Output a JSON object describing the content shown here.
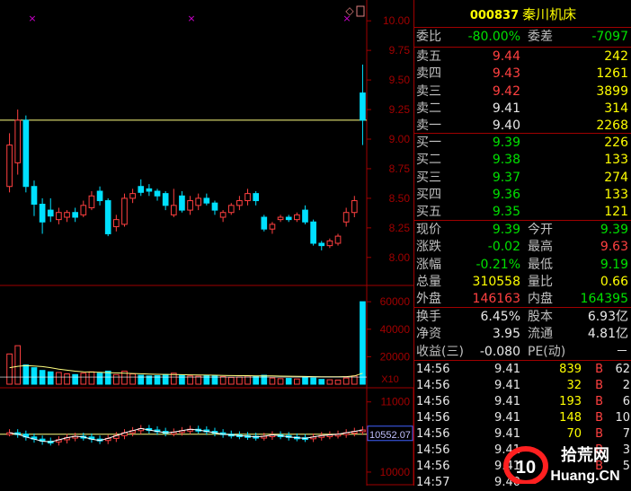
{
  "stock": {
    "code": "000837",
    "name": "秦川机床"
  },
  "weibi": {
    "label": "委比",
    "value": "-80.00%",
    "label2": "委差",
    "value2": "-7097"
  },
  "sell": [
    {
      "label": "卖五",
      "price": "9.44",
      "vol": "242"
    },
    {
      "label": "卖四",
      "price": "9.43",
      "vol": "1261"
    },
    {
      "label": "卖三",
      "price": "9.42",
      "vol": "3899"
    },
    {
      "label": "卖二",
      "price": "9.41",
      "vol": "314"
    },
    {
      "label": "卖一",
      "price": "9.40",
      "vol": "2268"
    }
  ],
  "buy": [
    {
      "label": "买一",
      "price": "9.39",
      "vol": "226"
    },
    {
      "label": "买二",
      "price": "9.38",
      "vol": "133"
    },
    {
      "label": "买三",
      "price": "9.37",
      "vol": "274"
    },
    {
      "label": "买四",
      "price": "9.36",
      "vol": "133"
    },
    {
      "label": "买五",
      "price": "9.35",
      "vol": "121"
    }
  ],
  "quote": [
    {
      "l1": "现价",
      "v1": "9.39",
      "l2": "今开",
      "v2": "9.39"
    },
    {
      "l1": "涨跌",
      "v1": "-0.02",
      "l2": "最高",
      "v2": "9.63"
    },
    {
      "l1": "涨幅",
      "v1": "-0.21%",
      "l2": "最低",
      "v2": "9.19"
    },
    {
      "l1": "总量",
      "v1": "310558",
      "l2": "量比",
      "v2": "0.66"
    },
    {
      "l1": "外盘",
      "v1": "146163",
      "l2": "内盘",
      "v2": "164395"
    }
  ],
  "fund": [
    {
      "l1": "换手",
      "v1": "6.45%",
      "l2": "股本",
      "v2": "6.93亿"
    },
    {
      "l1": "净资",
      "v1": "3.95",
      "l2": "流通",
      "v2": "4.81亿"
    },
    {
      "l1": "收益(三)",
      "v1": "-0.080",
      "l2": "PE(动)",
      "v2": "－"
    }
  ],
  "ticks": [
    {
      "time": "14:56",
      "price": "9.41",
      "vol": "839",
      "bs": "B",
      "num": "62"
    },
    {
      "time": "14:56",
      "price": "9.41",
      "vol": "32",
      "bs": "B",
      "num": "2"
    },
    {
      "time": "14:56",
      "price": "9.41",
      "vol": "193",
      "bs": "B",
      "num": "6"
    },
    {
      "time": "14:56",
      "price": "9.41",
      "vol": "148",
      "bs": "B",
      "num": "10"
    },
    {
      "time": "14:56",
      "price": "9.41",
      "vol": "70",
      "bs": "B",
      "num": "7"
    },
    {
      "time": "14:56",
      "price": "9.41",
      "vol": "",
      "bs": "B",
      "num": "3"
    },
    {
      "time": "14:56",
      "price": "9.41",
      "vol": "",
      "bs": "B",
      "num": "5"
    },
    {
      "time": "14:57",
      "price": "9.40",
      "vol": "",
      "bs": "",
      "num": ""
    }
  ],
  "axis": {
    "price": [
      "10.00",
      "9.75",
      "9.50",
      "9.25",
      "9.00",
      "8.75",
      "8.50",
      "8.25",
      "8.00"
    ],
    "volume": [
      "60000",
      "40000",
      "20000"
    ],
    "vol_unit": "X10",
    "index": [
      "11000",
      "10500",
      "10000"
    ],
    "index_current": "10552.07"
  },
  "watermark": {
    "line1": "拾荒网",
    "line2": "Huang.CN",
    "badge": "10"
  },
  "colors": {
    "up": "#ff4040",
    "down": "#00e0ff",
    "ma_line": "#ffff80",
    "grid": "#a00000"
  },
  "chart_data": {
    "type": "candlestick",
    "price_ylim": [
      7.9,
      10.1
    ],
    "reference_line": 9.16,
    "candles": [
      {
        "o": 8.6,
        "c": 8.95,
        "h": 9.05,
        "l": 8.55,
        "up": true
      },
      {
        "o": 8.8,
        "c": 9.16,
        "h": 9.25,
        "l": 8.7,
        "up": true
      },
      {
        "o": 9.16,
        "c": 8.6,
        "h": 9.2,
        "l": 8.55,
        "up": false
      },
      {
        "o": 8.6,
        "c": 8.45,
        "h": 8.65,
        "l": 8.35,
        "up": false
      },
      {
        "o": 8.45,
        "c": 8.3,
        "h": 8.5,
        "l": 8.2,
        "up": false
      },
      {
        "o": 8.4,
        "c": 8.35,
        "h": 8.5,
        "l": 8.3,
        "up": false
      },
      {
        "o": 8.32,
        "c": 8.38,
        "h": 8.42,
        "l": 8.28,
        "up": true
      },
      {
        "o": 8.34,
        "c": 8.38,
        "h": 8.4,
        "l": 8.3,
        "up": true
      },
      {
        "o": 8.38,
        "c": 8.34,
        "h": 8.42,
        "l": 8.3,
        "up": false
      },
      {
        "o": 8.36,
        "c": 8.44,
        "h": 8.48,
        "l": 8.34,
        "up": true
      },
      {
        "o": 8.42,
        "c": 8.52,
        "h": 8.56,
        "l": 8.4,
        "up": true
      },
      {
        "o": 8.56,
        "c": 8.48,
        "h": 8.6,
        "l": 8.44,
        "up": false
      },
      {
        "o": 8.48,
        "c": 8.2,
        "h": 8.5,
        "l": 8.18,
        "up": false
      },
      {
        "o": 8.26,
        "c": 8.32,
        "h": 8.36,
        "l": 8.22,
        "up": true
      },
      {
        "o": 8.28,
        "c": 8.5,
        "h": 8.54,
        "l": 8.26,
        "up": true
      },
      {
        "o": 8.5,
        "c": 8.54,
        "h": 8.58,
        "l": 8.46,
        "up": true
      },
      {
        "o": 8.55,
        "c": 8.6,
        "h": 8.66,
        "l": 8.52,
        "up": false
      },
      {
        "o": 8.58,
        "c": 8.56,
        "h": 8.62,
        "l": 8.52,
        "up": false
      },
      {
        "o": 8.56,
        "c": 8.52,
        "h": 8.58,
        "l": 8.48,
        "up": false
      },
      {
        "o": 8.54,
        "c": 8.44,
        "h": 8.56,
        "l": 8.4,
        "up": false
      },
      {
        "o": 8.44,
        "c": 8.36,
        "h": 8.58,
        "l": 8.34,
        "up": true
      },
      {
        "o": 8.52,
        "c": 8.4,
        "h": 8.56,
        "l": 8.38,
        "up": false
      },
      {
        "o": 8.4,
        "c": 8.48,
        "h": 8.52,
        "l": 8.36,
        "up": true
      },
      {
        "o": 8.44,
        "c": 8.5,
        "h": 8.54,
        "l": 8.4,
        "up": true
      },
      {
        "o": 8.5,
        "c": 8.46,
        "h": 8.54,
        "l": 8.44,
        "up": false
      },
      {
        "o": 8.46,
        "c": 8.4,
        "h": 8.48,
        "l": 8.36,
        "up": false
      },
      {
        "o": 8.34,
        "c": 8.38,
        "h": 8.4,
        "l": 8.3,
        "up": true
      },
      {
        "o": 8.38,
        "c": 8.44,
        "h": 8.46,
        "l": 8.36,
        "up": true
      },
      {
        "o": 8.44,
        "c": 8.48,
        "h": 8.52,
        "l": 8.4,
        "up": true
      },
      {
        "o": 8.48,
        "c": 8.54,
        "h": 8.58,
        "l": 8.44,
        "up": true
      },
      {
        "o": 8.54,
        "c": 8.48,
        "h": 8.56,
        "l": 8.44,
        "up": false
      },
      {
        "o": 8.34,
        "c": 8.24,
        "h": 8.36,
        "l": 8.22,
        "up": false
      },
      {
        "o": 8.24,
        "c": 8.28,
        "h": 8.3,
        "l": 8.2,
        "up": true
      },
      {
        "o": 8.32,
        "c": 8.34,
        "h": 8.36,
        "l": 8.3,
        "up": true
      },
      {
        "o": 8.34,
        "c": 8.32,
        "h": 8.36,
        "l": 8.3,
        "up": false
      },
      {
        "o": 8.32,
        "c": 8.36,
        "h": 8.38,
        "l": 8.3,
        "up": true
      },
      {
        "o": 8.4,
        "c": 8.3,
        "h": 8.44,
        "l": 8.28,
        "up": false
      },
      {
        "o": 8.3,
        "c": 8.12,
        "h": 8.32,
        "l": 8.1,
        "up": false
      },
      {
        "o": 8.12,
        "c": 8.1,
        "h": 8.14,
        "l": 8.06,
        "up": false
      },
      {
        "o": 8.1,
        "c": 8.14,
        "h": 8.16,
        "l": 8.08,
        "up": true
      },
      {
        "o": 8.12,
        "c": 8.18,
        "h": 8.2,
        "l": 8.1,
        "up": true
      },
      {
        "o": 8.3,
        "c": 8.38,
        "h": 8.42,
        "l": 8.26,
        "up": true
      },
      {
        "o": 8.38,
        "c": 8.48,
        "h": 8.52,
        "l": 8.34,
        "up": true
      },
      {
        "o": 9.39,
        "c": 9.16,
        "h": 9.63,
        "l": 8.95,
        "up": false
      }
    ],
    "volumes": [
      22000,
      28000,
      14000,
      12000,
      10000,
      9000,
      8500,
      7500,
      7000,
      8000,
      9000,
      8000,
      9500,
      7000,
      9500,
      7500,
      6500,
      6000,
      6200,
      7000,
      8000,
      6500,
      6000,
      5800,
      6500,
      6000,
      5500,
      5000,
      5200,
      6000,
      5500,
      6500,
      4500,
      4000,
      4200,
      3800,
      5000,
      4500,
      3500,
      3200,
      3000,
      4500,
      6000,
      60000
    ],
    "vol_ylim": [
      0,
      64000
    ],
    "vol_ma": [
      12000,
      13000,
      13500,
      13200,
      12800,
      12000,
      11000,
      10200,
      9500,
      9000,
      8800,
      8600,
      8400,
      8200,
      8000,
      7800,
      7600,
      7400,
      7200,
      7100,
      7000,
      6900,
      6800,
      6700,
      6600,
      6500,
      6400,
      6300,
      6200,
      6200,
      6100,
      6100,
      6000,
      5900,
      5800,
      5700,
      5600,
      5500,
      5400,
      5400,
      5400,
      5500,
      6000,
      8000
    ],
    "index_values": [
      10560,
      10540,
      10500,
      10470,
      10440,
      10430,
      10460,
      10490,
      10510,
      10500,
      10470,
      10450,
      10480,
      10520,
      10560,
      10590,
      10620,
      10600,
      10580,
      10560,
      10570,
      10590,
      10610,
      10600,
      10580,
      10560,
      10540,
      10530,
      10520,
      10510,
      10500,
      10510,
      10530,
      10520,
      10500,
      10490,
      10480,
      10500,
      10520,
      10530,
      10540,
      10560,
      10580,
      10600
    ],
    "index_ylim": [
      9820,
      11150
    ],
    "index_ref": 10540
  }
}
